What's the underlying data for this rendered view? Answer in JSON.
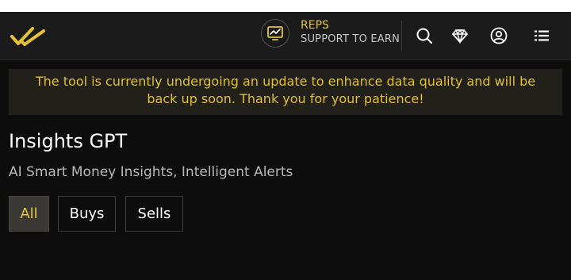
{
  "colors": {
    "accent": "#e6c23a",
    "background": "#0d0d0d",
    "navbar": "#1b1b1b",
    "banner_bg": "#22201a",
    "banner_text": "#e2c02c"
  },
  "header": {
    "logo_icon": "double-check-logo",
    "reps": {
      "icon": "chart-monitor-icon",
      "title": "REPS",
      "subtitle": "SUPPORT TO EARN"
    },
    "icons": [
      "search-icon",
      "diamond-icon",
      "user-circle-icon",
      "list-menu-icon"
    ]
  },
  "banner": {
    "text": "The tool is currently undergoing an update to enhance data quality and will be back up soon. Thank you for your patience!"
  },
  "main": {
    "title": "Insights GPT",
    "subtitle": "AI Smart Money Insights, Intelligent Alerts",
    "tabs": [
      {
        "label": "All",
        "active": true
      },
      {
        "label": "Buys",
        "active": false
      },
      {
        "label": "Sells",
        "active": false
      }
    ]
  }
}
